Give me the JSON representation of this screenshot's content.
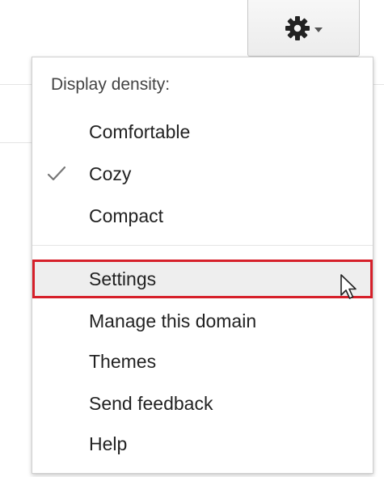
{
  "toolbar": {
    "gear_button": {
      "icon": "gear-icon",
      "dropdown_icon": "caret-down-icon"
    }
  },
  "menu": {
    "density_heading": "Display density:",
    "density_options": [
      {
        "label": "Comfortable",
        "selected": false
      },
      {
        "label": "Cozy",
        "selected": true
      },
      {
        "label": "Compact",
        "selected": false
      }
    ],
    "check_icon": "checkmark-icon",
    "items": [
      {
        "label": "Settings",
        "highlighted": true
      },
      {
        "label": "Manage this domain"
      },
      {
        "label": "Themes"
      },
      {
        "label": "Send feedback"
      },
      {
        "label": "Help"
      }
    ]
  },
  "pointer": {
    "icon": "mouse-pointer-icon"
  },
  "colors": {
    "highlight_border": "#d6202a",
    "highlight_background": "#eeeeee",
    "menu_border": "#cfcfcf",
    "text": "#222222",
    "heading_text": "#444444",
    "checkmark": "#777777"
  }
}
